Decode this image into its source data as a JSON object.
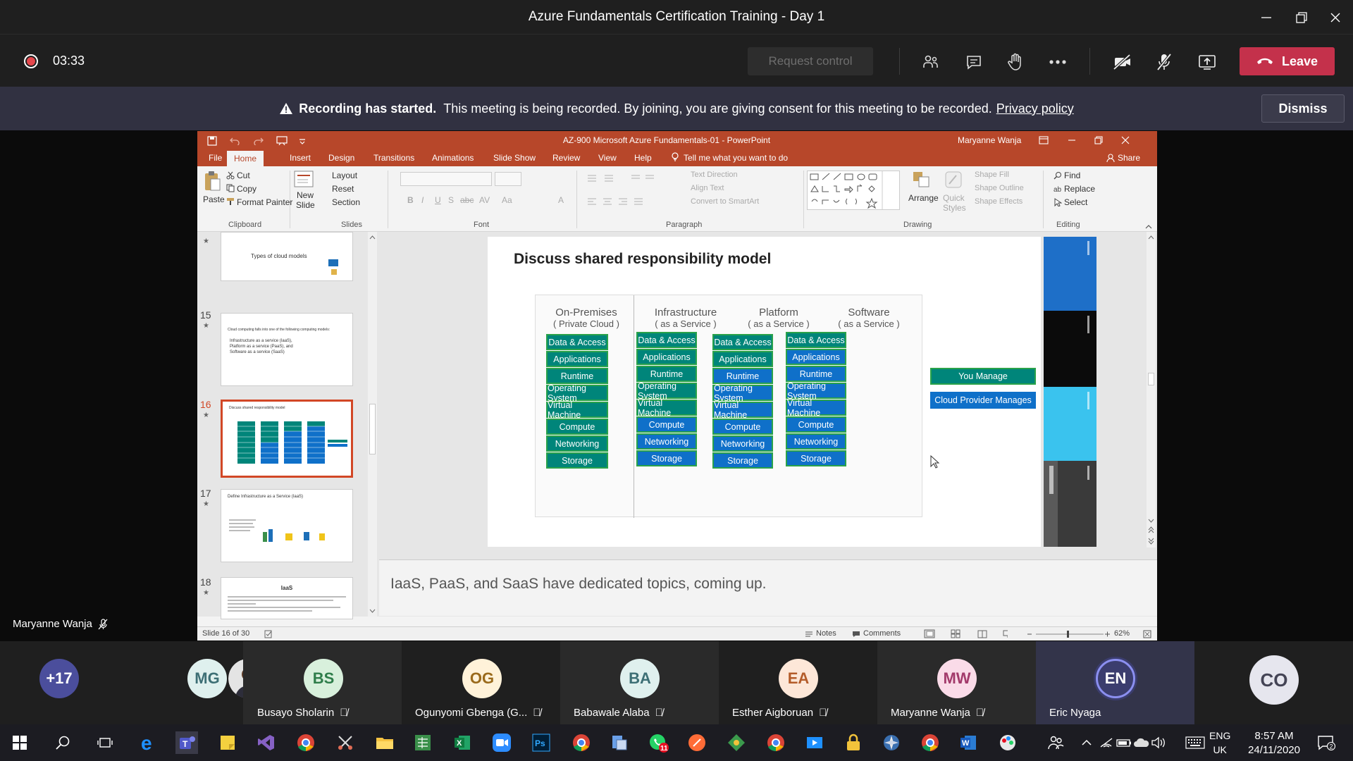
{
  "window": {
    "title": "Azure Fundamentals Certification Training - Day 1"
  },
  "call": {
    "timer": "03:33",
    "request_control": "Request control",
    "leave": "Leave"
  },
  "banner": {
    "bold": "Recording has started.",
    "text": "This meeting is being recorded. By joining, you are giving consent for this meeting to be recorded.",
    "link": "Privacy policy",
    "dismiss": "Dismiss"
  },
  "presenter": {
    "name": "Maryanne Wanja"
  },
  "ppt": {
    "title": "AZ-900 Microsoft Azure Fundamentals-01 - PowerPoint",
    "user": "Maryanne Wanja",
    "share": "Share",
    "tabs": [
      "File",
      "Home",
      "Insert",
      "Design",
      "Transitions",
      "Animations",
      "Slide Show",
      "Review",
      "View",
      "Help"
    ],
    "tell_me": "Tell me what you want to do",
    "ribbon": {
      "paste": "Paste",
      "cut": "Cut",
      "copy": "Copy",
      "format_painter": "Format Painter",
      "clipboard": "Clipboard",
      "new_slide_1": "New",
      "new_slide_2": "Slide",
      "layout": "Layout",
      "reset": "Reset",
      "section": "Section",
      "slides": "Slides",
      "font": "Font",
      "paragraph": "Paragraph",
      "text_direction": "Text Direction",
      "align_text": "Align Text",
      "convert_smartart": "Convert to SmartArt",
      "arrange": "Arrange",
      "quick_1": "Quick",
      "quick_2": "Styles",
      "shape_fill": "Shape Fill",
      "shape_outline": "Shape Outline",
      "shape_effects": "Shape Effects",
      "drawing": "Drawing",
      "find": "Find",
      "replace": "Replace",
      "select": "Select",
      "editing": "Editing",
      "font_buttons": [
        "B",
        "I",
        "U",
        "S",
        "abc",
        "AV",
        "Aa",
        "A"
      ]
    },
    "thumbs": [
      {
        "num": "",
        "title": "Types of cloud models"
      },
      {
        "num": "15",
        "title": "Cloud computing falls into one of the following computing models:",
        "bullets": [
          "Infrastructure as a service (IaaS),",
          "Platform as a service (PaaS), and",
          "Software as a service (SaaS)"
        ]
      },
      {
        "num": "16",
        "title": "Discuss shared responsibility model"
      },
      {
        "num": "17",
        "title": "Define Infrastructure as a Service (IaaS)"
      },
      {
        "num": "18",
        "title": "IaaS"
      }
    ],
    "slide": {
      "title": "Discuss shared responsibility model",
      "columns": [
        {
          "name": "On-Premises",
          "sub": "( Private Cloud )",
          "cells": [
            {
              "t": "Data & Access",
              "c": "teal"
            },
            {
              "t": "Applications",
              "c": "teal"
            },
            {
              "t": "Runtime",
              "c": "teal"
            },
            {
              "t": "Operating System",
              "c": "teal"
            },
            {
              "t": "Virtual Machine",
              "c": "teal"
            },
            {
              "t": "Compute",
              "c": "teal"
            },
            {
              "t": "Networking",
              "c": "teal"
            },
            {
              "t": "Storage",
              "c": "teal"
            }
          ]
        },
        {
          "name": "Infrastructure",
          "sub": "( as a Service )",
          "cells": [
            {
              "t": "Data & Access",
              "c": "teal"
            },
            {
              "t": "Applications",
              "c": "teal"
            },
            {
              "t": "Runtime",
              "c": "teal"
            },
            {
              "t": "Operating System",
              "c": "teal"
            },
            {
              "t": "Virtual Machine",
              "c": "teal"
            },
            {
              "t": "Compute",
              "c": "blue"
            },
            {
              "t": "Networking",
              "c": "blue"
            },
            {
              "t": "Storage",
              "c": "blue"
            }
          ]
        },
        {
          "name": "Platform",
          "sub": "( as a Service )",
          "cells": [
            {
              "t": "Data & Access",
              "c": "teal"
            },
            {
              "t": "Applications",
              "c": "teal"
            },
            {
              "t": "Runtime",
              "c": "blue"
            },
            {
              "t": "Operating System",
              "c": "blue"
            },
            {
              "t": "Virtual Machine",
              "c": "blue"
            },
            {
              "t": "Compute",
              "c": "blue"
            },
            {
              "t": "Networking",
              "c": "blue"
            },
            {
              "t": "Storage",
              "c": "blue"
            }
          ]
        },
        {
          "name": "Software",
          "sub": "( as a Service )",
          "cells": [
            {
              "t": "Data & Access",
              "c": "teal"
            },
            {
              "t": "Applications",
              "c": "blue"
            },
            {
              "t": "Runtime",
              "c": "blue"
            },
            {
              "t": "Operating System",
              "c": "blue"
            },
            {
              "t": "Virtual Machine",
              "c": "blue"
            },
            {
              "t": "Compute",
              "c": "blue"
            },
            {
              "t": "Networking",
              "c": "blue"
            },
            {
              "t": "Storage",
              "c": "blue"
            }
          ]
        }
      ],
      "legend_you": "You Manage",
      "legend_provider": "Cloud Provider Manages"
    },
    "notes": "IaaS, PaaS, and SaaS have dedicated topics, coming up.",
    "status": {
      "slide": "Slide 16 of 30",
      "notes": "Notes",
      "comments": "Comments",
      "zoom": "62%"
    }
  },
  "participants": [
    {
      "initials": "+17",
      "name": "",
      "bg": "#4b4e9c",
      "fg": "#ffffff"
    },
    {
      "initials": "",
      "name": "",
      "bg": "#dcdcdc",
      "fg": "#000000",
      "photo": true
    },
    {
      "initials": "MG",
      "name": "",
      "bg": "#dff0ee",
      "fg": "#3d6f75"
    },
    {
      "initials": "BS",
      "name": "Busayo Sholarin",
      "bg": "#d8f0dc",
      "fg": "#2e7d4a"
    },
    {
      "initials": "OG",
      "name": "Ogunyomi Gbenga (G...",
      "bg": "#fff2d9",
      "fg": "#9a6a1b"
    },
    {
      "initials": "BA",
      "name": "Babawale Alaba",
      "bg": "#dff0ee",
      "fg": "#3d6f75"
    },
    {
      "initials": "EA",
      "name": "Esther Aigboruan",
      "bg": "#fde7d8",
      "fg": "#b45c2a"
    },
    {
      "initials": "MW",
      "name": "Maryanne Wanja",
      "bg": "#fadbe8",
      "fg": "#a33a6b"
    },
    {
      "initials": "EN",
      "name": "Eric Nyaga",
      "bg": "#3b3d6e",
      "fg": "#ffffff"
    },
    {
      "initials": "CO",
      "name": "",
      "bg": "#e6e6ee",
      "fg": "#444455"
    }
  ],
  "taskbar": {
    "lang1": "ENG",
    "lang2": "UK",
    "time": "8:57 AM",
    "date": "24/11/2020",
    "whatsapp_badge": "11"
  }
}
